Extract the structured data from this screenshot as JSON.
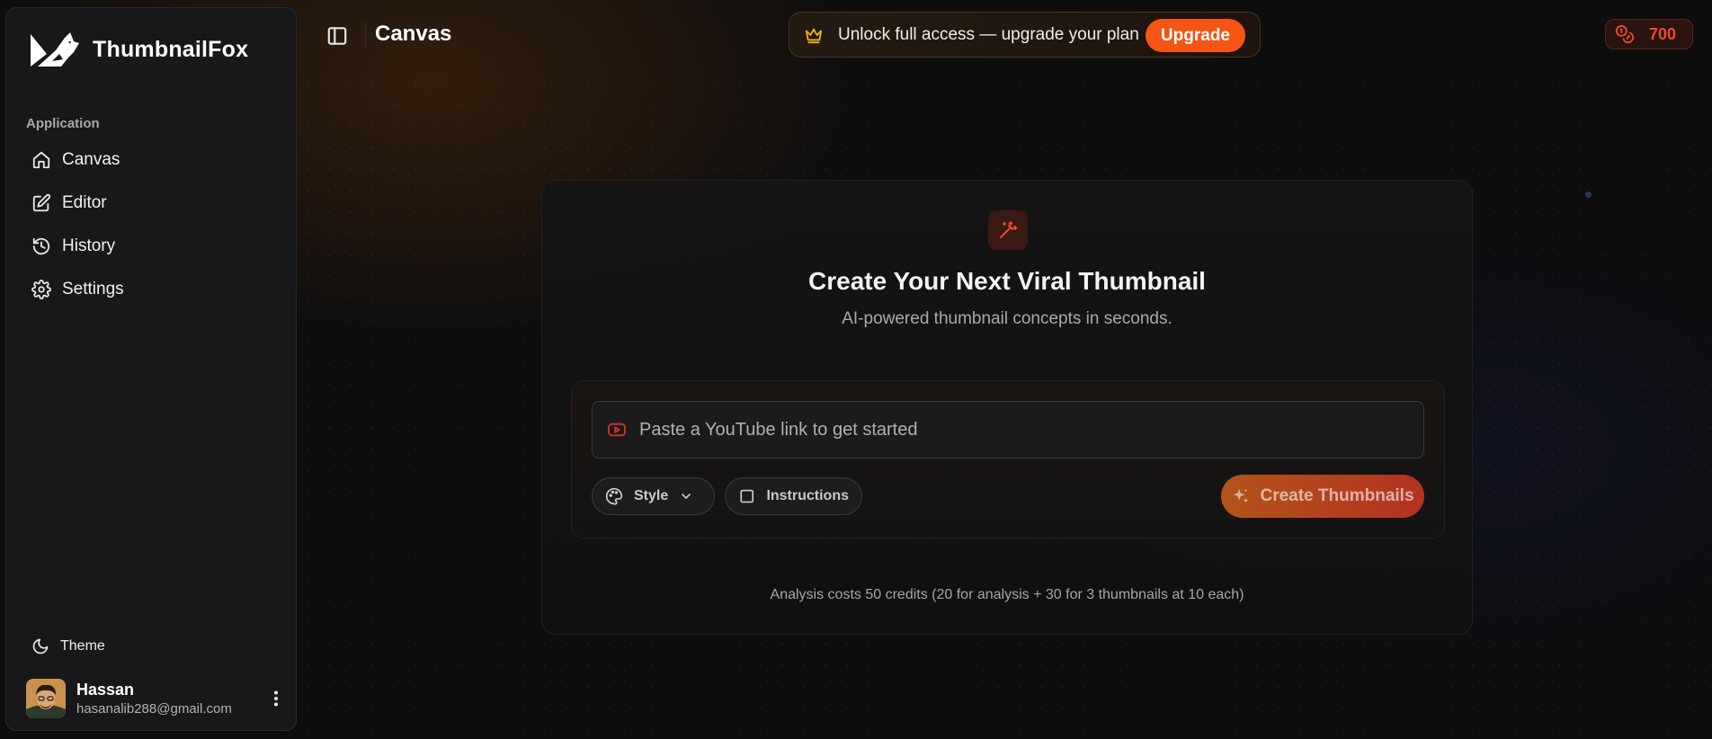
{
  "app": {
    "name": "ThumbnailFox"
  },
  "sidebar": {
    "section_label": "Application",
    "items": [
      {
        "label": "Canvas",
        "icon": "home-icon"
      },
      {
        "label": "Editor",
        "icon": "edit-icon"
      },
      {
        "label": "History",
        "icon": "history-icon"
      },
      {
        "label": "Settings",
        "icon": "gear-icon"
      }
    ],
    "theme_label": "Theme",
    "user": {
      "name": "Hassan",
      "email": "hasanalib288@gmail.com"
    }
  },
  "header": {
    "title": "Canvas",
    "promo_text": "Unlock full access — upgrade your plan",
    "upgrade_label": "Upgrade",
    "credits": "700"
  },
  "main": {
    "title": "Create Your Next Viral Thumbnail",
    "subtitle": "AI-powered thumbnail concepts in seconds.",
    "link_placeholder": "Paste a YouTube link to get started",
    "link_value": "",
    "style_label": "Style",
    "instructions_label": "Instructions",
    "create_label": "Create Thumbnails",
    "cost_note": "Analysis costs 50 credits (20 for analysis + 30 for 3 thumbnails at 10 each)"
  },
  "colors": {
    "accent": "#f45514",
    "credits": "#f0492b",
    "background": "#0d0d0e",
    "sidebar": "#18181a"
  }
}
